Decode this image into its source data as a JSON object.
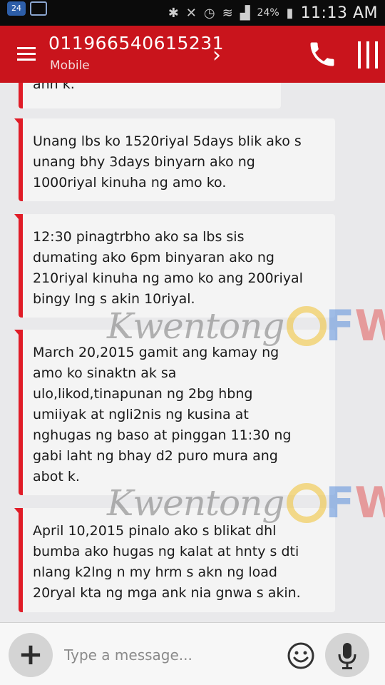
{
  "status_bar": {
    "badge": "24",
    "battery": "24%",
    "time": "11:13 AM"
  },
  "header": {
    "contact_number": "011966540615231",
    "contact_type": "Mobile"
  },
  "messages": [
    {
      "text": "ahh k."
    },
    {
      "text": "Unang lbs ko 1520riyal 5days blik ako s\nunang bhy 3days binyarn ako ng\n1000riyal kinuha ng amo ko."
    },
    {
      "text": "12:30 pinagtrbho ako sa lbs sis\ndumating ako 6pm binyaran ako ng\n210riyal kinuha ng amo ko ang 200riyal\nbingy lng s akin 10riyal."
    },
    {
      "text": "March 20,2015 gamit ang kamay ng\namo ko sinaktn ak sa\nulo,likod,tinapunan ng 2bg hbng\numiiyak at ngli2nis ng kusina at\nnghugas ng baso at pinggan 11:30 ng\ngabi laht ng bhay d2 puro mura ang\nabot k."
    },
    {
      "text": "April 10,2015 pinalo ako s blikat dhl\nbumba ako hugas ng kalat at hnty s dti\nnlang k2lng n my hrm s akn ng load\n20ryal kta ng mga ank nia gnwa s akin."
    }
  ],
  "watermark": {
    "script": "Kwentong",
    "f": "F",
    "w": "W"
  },
  "compose": {
    "add_label": "+",
    "placeholder": "Type a message..."
  },
  "colors": {
    "header": "#c9141c",
    "bubble_accent": "#e01c27"
  }
}
